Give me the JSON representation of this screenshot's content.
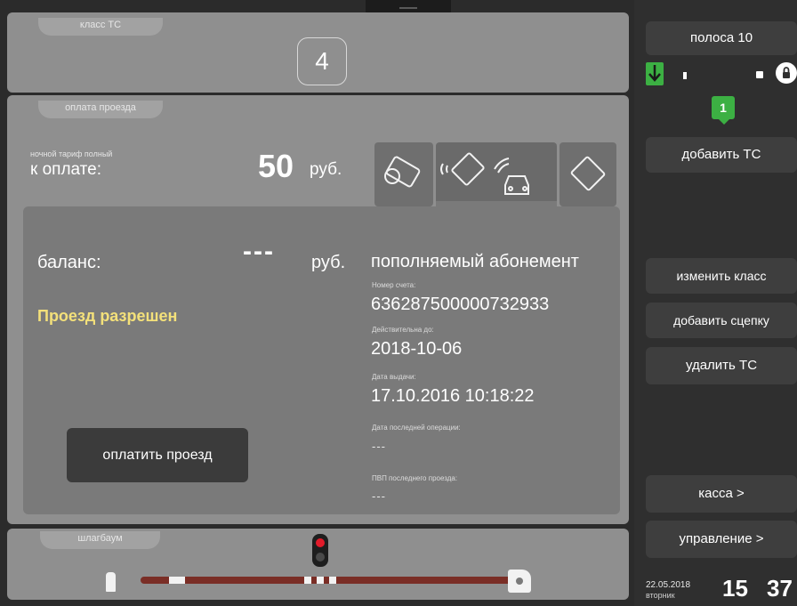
{
  "class_panel": {
    "tab": "класс ТС",
    "class_value": "4"
  },
  "payment_panel": {
    "tab": "оплата проезда",
    "tariff": "ночной тариф полный",
    "to_pay_label": "к оплате:",
    "amount": "50",
    "currency": "руб."
  },
  "payment_methods": [
    "cash-card-icon",
    "contactless-card-vehicle-icon",
    "card-icon"
  ],
  "balance": {
    "label": "баланс:",
    "value": "---",
    "currency": "руб.",
    "status": "Проезд разрешен",
    "status_color": "#f3e07a"
  },
  "subscription": {
    "title": "пополняемый абонемент",
    "account_label": "Номер счета:",
    "account": "636287500000732933",
    "valid_label": "Действительна до:",
    "valid": "2018-10-06",
    "issue_label": "Дата выдачи:",
    "issue": "17.10.2016 10:18:22",
    "last_op_label": "Дата последней операции:",
    "last_op": "---",
    "last_pvp_label": "ПВП последнего проезда:",
    "last_pvp": "---"
  },
  "pay_button": "оплатить проезд",
  "barrier_panel": {
    "tab": "шлагбаум"
  },
  "sidebar": {
    "lane": "полоса 10",
    "queue_count": "1",
    "add_vehicle": "добавить ТС",
    "change_class": "изменить класс",
    "add_trailer": "добавить сцепку",
    "delete_vehicle": "удалить ТС",
    "cashbox": "касса >",
    "control": "управление >"
  },
  "clock": {
    "date": "22.05.2018",
    "weekday": "вторник",
    "hours": "15",
    "minutes": "37"
  },
  "colors": {
    "accent_green": "#3cb043",
    "signal_red": "#e21b2a",
    "barrier_arm": "#7a2e26"
  }
}
